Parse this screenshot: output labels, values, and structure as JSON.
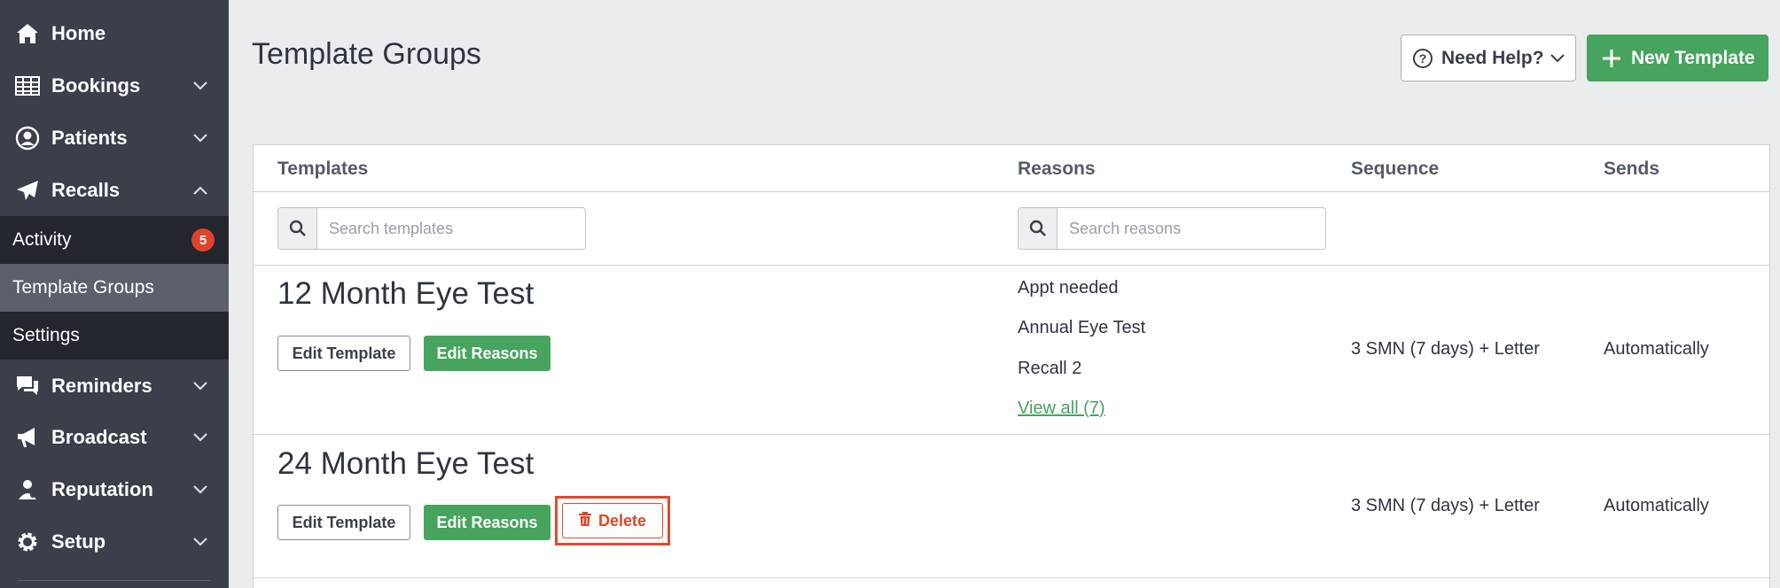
{
  "sidebar": {
    "items": [
      {
        "label": "Home",
        "icon": "home-icon"
      },
      {
        "label": "Bookings",
        "icon": "calendar-grid-icon"
      },
      {
        "label": "Patients",
        "icon": "user-circle-icon"
      },
      {
        "label": "Recalls",
        "icon": "paper-plane-icon"
      },
      {
        "label": "Reminders",
        "icon": "chat-bubbles-icon"
      },
      {
        "label": "Broadcast",
        "icon": "megaphone-icon"
      },
      {
        "label": "Reputation",
        "icon": "user-badge-icon"
      },
      {
        "label": "Setup",
        "icon": "gear-icon"
      }
    ],
    "recalls_sub": [
      {
        "label": "Activity",
        "badge": "5"
      },
      {
        "label": "Template Groups",
        "active": true
      },
      {
        "label": "Settings"
      }
    ]
  },
  "header": {
    "title": "Template Groups",
    "help_label": "Need Help?",
    "new_label": "New Template"
  },
  "table": {
    "columns": [
      "Templates",
      "Reasons",
      "Sequence",
      "Sends"
    ],
    "search_templates_placeholder": "Search templates",
    "search_reasons_placeholder": "Search reasons",
    "rows": [
      {
        "title": "12 Month Eye Test",
        "edit_template": "Edit Template",
        "edit_reasons": "Edit Reasons",
        "reasons": [
          "Appt needed",
          "Annual Eye Test",
          "Recall 2"
        ],
        "view_all": "View all (7)",
        "sequence": "3 SMN (7 days) + Letter",
        "sends": "Automatically"
      },
      {
        "title": "24 Month Eye Test",
        "edit_template": "Edit Template",
        "edit_reasons": "Edit Reasons",
        "delete": "Delete",
        "sequence": "3 SMN (7 days) + Letter",
        "sends": "Automatically"
      }
    ]
  },
  "colors": {
    "sidebar": "#3a3f4a",
    "submenu": "#23262d",
    "active": "#5b606b",
    "green": "#46a45e",
    "danger": "#e04a2c"
  }
}
